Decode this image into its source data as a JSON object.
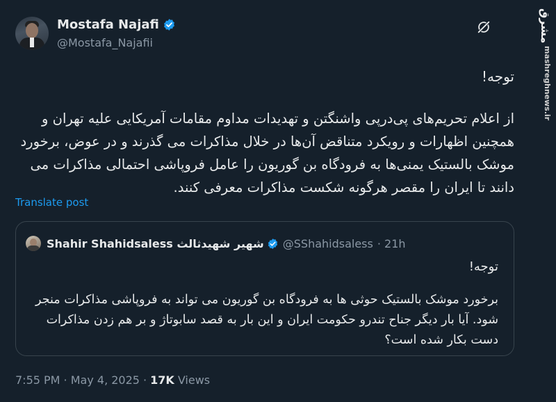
{
  "author": {
    "name": "Mostafa Najafi",
    "handle": "@Mostafa_Najafii"
  },
  "watermark": {
    "logo": "مشرق",
    "site": "mashreghnews.ir"
  },
  "tweet": {
    "title": "توجه!",
    "body": "از اعلام تحریم‌های پی‌درپی واشنگتن و تهدیدات مداوم مقامات آمریکایی علیه تهران و همچنین اظهارات و رویکرد متناقض آن‌ها در خلال مذاکرات می گذرند و در عوض، برخورد موشک بالستیک یمنی‌ها به فرودگاه بن گوریون را عامل فروپاشی احتمالی مذاکرات می دانند تا ایران را مقصر هرگونه شکست مذاکرات معرفی کنند.",
    "translate_label": "Translate post"
  },
  "quote": {
    "name": "Shahir Shahidsaless شهیر شهیدثالث",
    "handle": "@SShahidsaless",
    "time": "· 21h",
    "title": "توجه!",
    "body": "برخورد موشک بالستیک حوثی ها به فرودگاه بن گوریون می تواند به فروپاشی مذاکرات منجر شود. آیا بار دیگر جناح تندرو حکومت ایران و این بار به قصد سابوتاژ و بر هم زدن مذاکرات دست بکار شده است؟"
  },
  "meta": {
    "timestamp": "7:55 PM · May 4, 2025 ·",
    "views_count": "17K",
    "views_label": "Views"
  },
  "icons": {
    "verified": "verified-badge-icon",
    "grok": "grok-icon"
  },
  "colors": {
    "background": "#15202b",
    "link": "#1d9bf0",
    "verified": "#1d9bf0",
    "secondary_text": "#8b98a5"
  }
}
